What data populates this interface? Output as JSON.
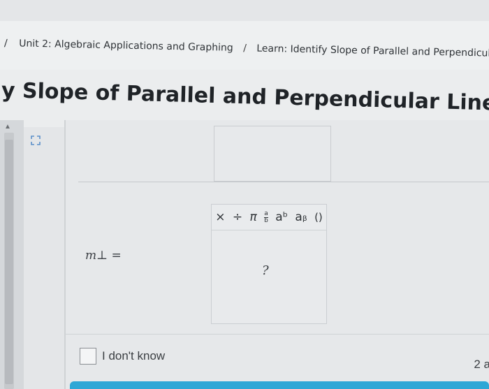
{
  "breadcrumb": {
    "lead_separator": "/",
    "unit": "Unit 2: Algebraic Applications and Graphing",
    "separator": "/",
    "lesson": "Learn: Identify Slope of Parallel and Perpendicular Lines"
  },
  "page_title": "y Slope of Parallel and Perpendicular Lines",
  "icons": {
    "expand": "expand-icon",
    "scroll_up": "scroll-up-icon"
  },
  "math_toolbar": {
    "times": "×",
    "divide": "÷",
    "pi": "π",
    "fraction_num": "a",
    "fraction_den": "b",
    "superscript": "aᵇ",
    "subscript": "aᵦ",
    "parentheses": "()"
  },
  "question": {
    "label": "m⊥ =",
    "answer_placeholder": "?"
  },
  "dont_know_label": "I don't know",
  "page_indicator": "2 a",
  "colors": {
    "accent": "#2fa7d6",
    "icon": "#5b8fc9"
  }
}
